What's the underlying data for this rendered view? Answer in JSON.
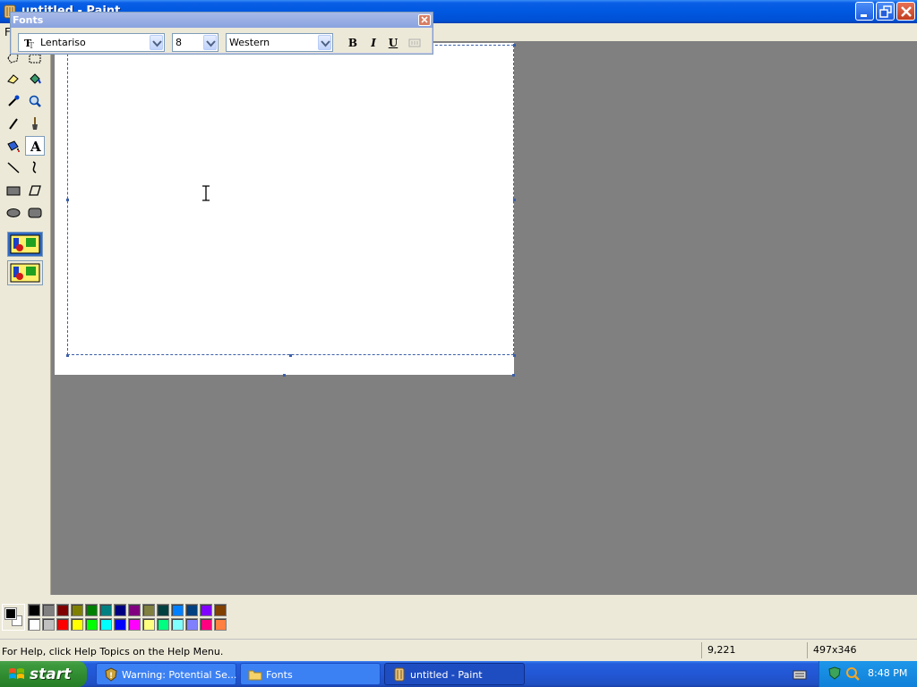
{
  "window": {
    "title": "untitled - Paint"
  },
  "menubar": {
    "first_item": "F"
  },
  "fonts_toolbar": {
    "title": "Fonts",
    "font_name": "Lentariso",
    "font_size": "8",
    "script": "Western",
    "bold_label": "B",
    "italic_label": "I",
    "underline_label": "U"
  },
  "palette": {
    "foreground": "#000000",
    "background": "#ffffff",
    "top_row": [
      "#000000",
      "#808080",
      "#800000",
      "#808000",
      "#008000",
      "#008080",
      "#000080",
      "#800080",
      "#808040",
      "#004040",
      "#0080ff",
      "#004080",
      "#8000ff",
      "#804000"
    ],
    "bottom_row": [
      "#ffffff",
      "#c0c0c0",
      "#ff0000",
      "#ffff00",
      "#00ff00",
      "#00ffff",
      "#0000ff",
      "#ff00ff",
      "#ffff80",
      "#00ff80",
      "#80ffff",
      "#8080ff",
      "#ff0080",
      "#ff8040"
    ]
  },
  "statusbar": {
    "help_text": "For Help, click Help Topics on the Help Menu.",
    "cursor_position": "9,221",
    "selection_size": "497x346"
  },
  "taskbar": {
    "start_label": "start",
    "tasks": [
      {
        "label": "Warning: Potential Se...",
        "icon": "shield-warning-icon"
      },
      {
        "label": "Fonts",
        "icon": "folder-icon"
      },
      {
        "label": "untitled - Paint",
        "icon": "paint-icon",
        "active": true
      }
    ],
    "clock": "8:48 PM"
  }
}
